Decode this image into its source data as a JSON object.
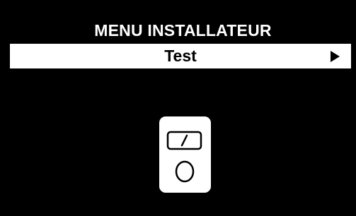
{
  "header": {
    "title": "MENU INSTALLATEUR"
  },
  "menu": {
    "selected_item": {
      "label": "Test",
      "arrow_icon": "right-triangle-icon"
    }
  },
  "illustration": {
    "icon": "multimeter-test-icon"
  },
  "colors": {
    "background": "#000000",
    "highlight": "#ffffff",
    "text_on_dark": "#ffffff",
    "text_on_light": "#000000"
  }
}
